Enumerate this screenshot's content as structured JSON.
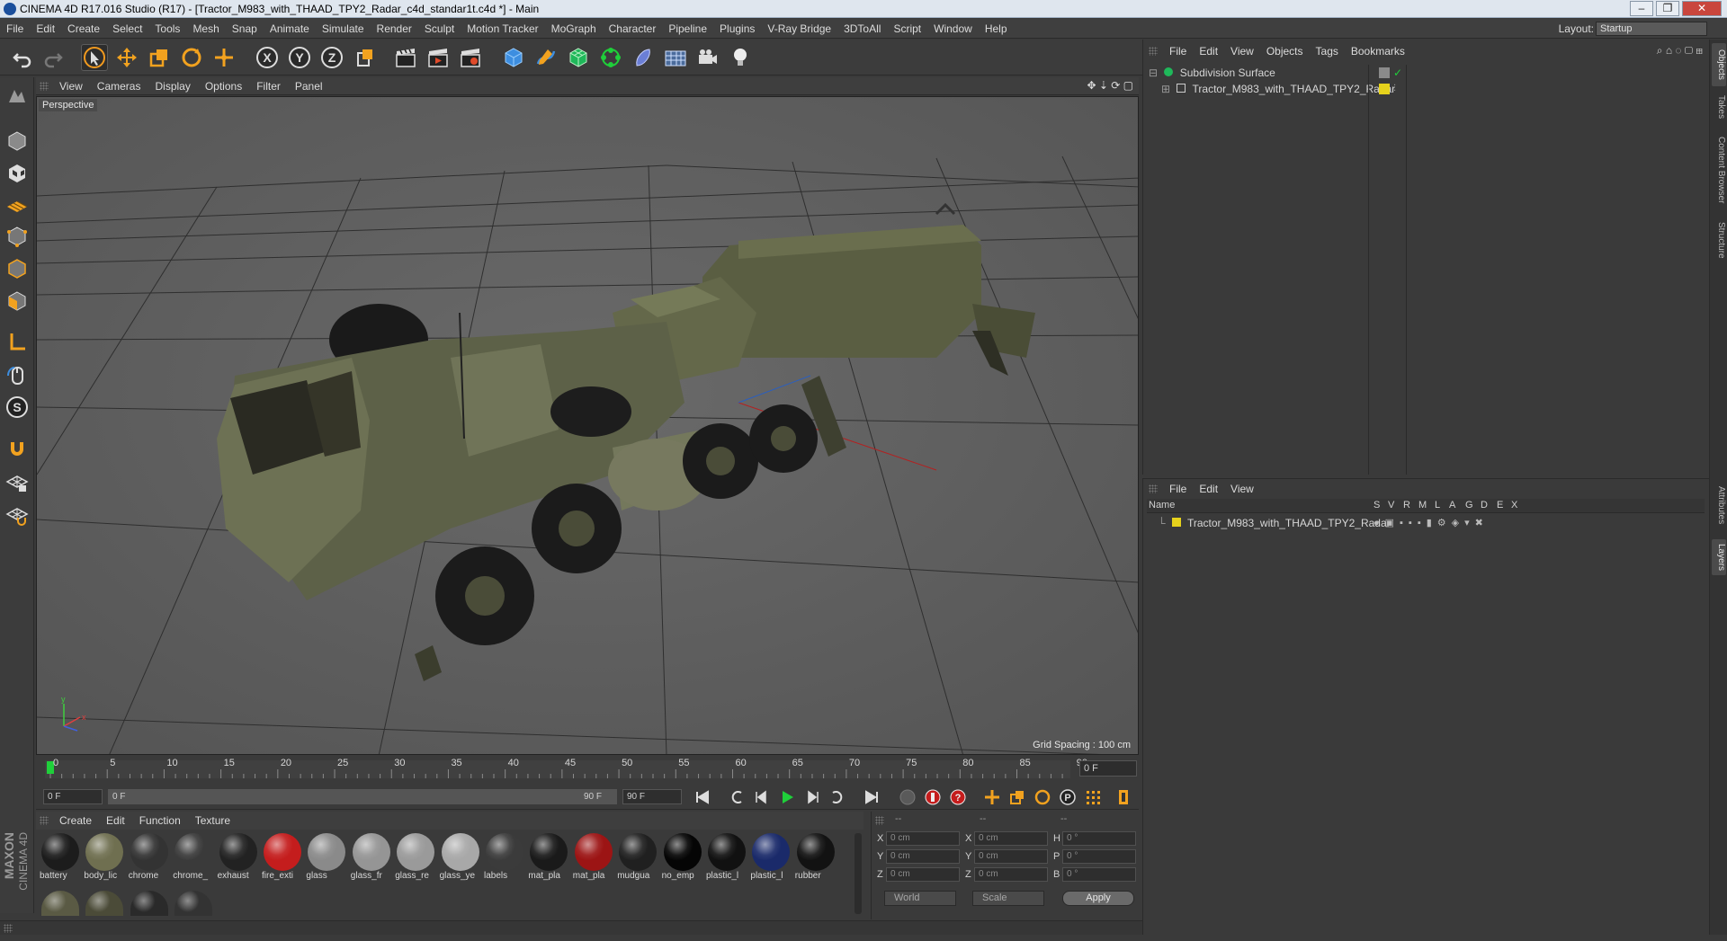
{
  "window": {
    "title": "CINEMA 4D R17.016 Studio (R17) - [Tractor_M983_with_THAAD_TPY2_Radar_c4d_standar1t.c4d *] - Main",
    "minimize": "‒",
    "maximize": "❐",
    "close": "✕"
  },
  "menubar": {
    "items": [
      "File",
      "Edit",
      "Create",
      "Select",
      "Tools",
      "Mesh",
      "Snap",
      "Animate",
      "Simulate",
      "Render",
      "Sculpt",
      "Motion Tracker",
      "MoGraph",
      "Character",
      "Pipeline",
      "Plugins",
      "V-Ray Bridge",
      "3DToAll",
      "Script",
      "Window",
      "Help"
    ],
    "layout_label": "Layout:",
    "layout_value": "Startup"
  },
  "viewport": {
    "menu": [
      "View",
      "Cameras",
      "Display",
      "Options",
      "Filter",
      "Panel"
    ],
    "label": "Perspective",
    "grid_spacing": "Grid Spacing : 100 cm"
  },
  "timeline": {
    "ticks": [
      "0",
      "5",
      "10",
      "15",
      "20",
      "25",
      "30",
      "35",
      "40",
      "45",
      "50",
      "55",
      "60",
      "65",
      "70",
      "75",
      "80",
      "85",
      "90"
    ],
    "current_frame": "0 F",
    "start_field": "0 F",
    "range_start": "0 F",
    "range_end": "90 F",
    "end_field": "90 F"
  },
  "materials": {
    "menu": [
      "Create",
      "Edit",
      "Function",
      "Texture"
    ],
    "items": [
      {
        "label": "battery",
        "color": "#1c1c1c"
      },
      {
        "label": "body_lic",
        "color": "#6f6f50"
      },
      {
        "label": "chrome",
        "color": "#333333"
      },
      {
        "label": "chrome_",
        "color": "#3a3a3a"
      },
      {
        "label": "exhaust",
        "color": "#222222"
      },
      {
        "label": "fire_exti",
        "color": "#c41d1d"
      },
      {
        "label": "glass",
        "color": "#8a8a8a"
      },
      {
        "label": "glass_fr",
        "color": "#959595"
      },
      {
        "label": "glass_re",
        "color": "#9a9a9a"
      },
      {
        "label": "glass_ye",
        "color": "#a8a8a8"
      },
      {
        "label": "labels",
        "color": "#3b3b3b"
      },
      {
        "label": "mat_pla",
        "color": "#1a1a1a"
      },
      {
        "label": "mat_pla",
        "color": "#9c1414"
      },
      {
        "label": "mudgua",
        "color": "#202020"
      },
      {
        "label": "no_emp",
        "color": "#050505"
      },
      {
        "label": "plastic_l",
        "color": "#111111"
      },
      {
        "label": "plastic_l",
        "color": "#1a2a6a"
      },
      {
        "label": "rubber",
        "color": "#121212"
      }
    ],
    "second_row_colors": [
      "#5a5a44",
      "#4b4b38",
      "#2a2a2a",
      "#333333"
    ]
  },
  "coords": {
    "header": [
      "--",
      "--",
      "--"
    ],
    "rows": [
      {
        "a": "X",
        "av": "0 cm",
        "b": "X",
        "bv": "0 cm",
        "c": "H",
        "cv": "0 °"
      },
      {
        "a": "Y",
        "av": "0 cm",
        "b": "Y",
        "bv": "0 cm",
        "c": "P",
        "cv": "0 °"
      },
      {
        "a": "Z",
        "av": "0 cm",
        "b": "Z",
        "bv": "0 cm",
        "c": "B",
        "cv": "0 °"
      }
    ],
    "mode1": "World",
    "mode2": "Scale",
    "apply": "Apply"
  },
  "objects": {
    "menu": [
      "File",
      "Edit",
      "View",
      "Objects",
      "Tags",
      "Bookmarks"
    ],
    "rows": [
      {
        "name": "Subdivision Surface"
      },
      {
        "name": "Tractor_M983_with_THAAD_TPY2_Radar"
      }
    ]
  },
  "layers": {
    "menu": [
      "File",
      "Edit",
      "View"
    ],
    "columns": [
      "Name",
      "S",
      "V",
      "R",
      "M",
      "L",
      "A",
      "G",
      "D",
      "E",
      "X"
    ],
    "row_name": "Tractor_M983_with_THAAD_TPY2_Radar"
  },
  "right_tabs": [
    "Objects",
    "Takes",
    "Content Browser",
    "Structure",
    "Attributes",
    "Layers"
  ],
  "brand": {
    "line1": "MAXON",
    "line2": "CINEMA 4D"
  },
  "colors": {
    "accent": "#3d8ee0",
    "green": "#1fcf3a",
    "layer_yellow": "#e6d21c"
  }
}
